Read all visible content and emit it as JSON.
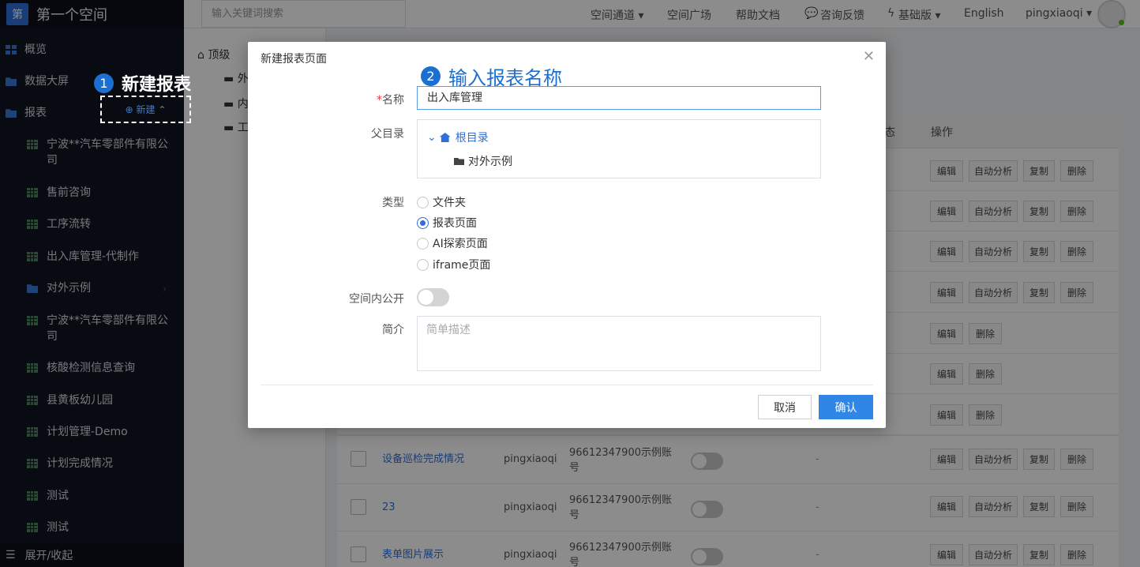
{
  "brand": {
    "logo_char": "第",
    "title": "第一个空间"
  },
  "sidebar": {
    "items": [
      {
        "label": "概览",
        "icon": "dashboard-icon"
      },
      {
        "label": "数据大屏",
        "icon": "folder-icon"
      },
      {
        "label": "报表",
        "icon": "folder-icon"
      }
    ],
    "sub_items": [
      {
        "label": "宁波**汽车零部件有限公司"
      },
      {
        "label": "售前咨询"
      },
      {
        "label": "工序流转"
      },
      {
        "label": "出入库管理-代制作"
      },
      {
        "label": "对外示例"
      },
      {
        "label": "宁波**汽车零部件有限公司"
      },
      {
        "label": "核酸检测信息查询"
      },
      {
        "label": "县黄板幼儿园"
      },
      {
        "label": "计划管理-Demo"
      },
      {
        "label": "计划完成情况"
      },
      {
        "label": "测试"
      },
      {
        "label": "测试"
      }
    ],
    "new_label": "新建",
    "footer_label": "展开/收起"
  },
  "callouts": {
    "one": {
      "num": "1",
      "text": "新建报表"
    },
    "two": {
      "num": "2",
      "text": "输入报表名称"
    }
  },
  "topbar": {
    "search_placeholder": "输入关键词搜索",
    "nav": [
      "空间通道 ▾",
      "空间广场",
      "帮助文档",
      "咨询反馈",
      "基础版 ▾",
      "English",
      "pingxiaoqi ▾"
    ]
  },
  "tree_panel": {
    "top": "顶级",
    "rows": [
      "外",
      "内",
      "工"
    ]
  },
  "table": {
    "col_status": "态",
    "col_action": "操作",
    "btn_edit": "编辑",
    "btn_auto": "自动分析",
    "btn_copy": "复制",
    "btn_delete": "删除",
    "rows": [
      {
        "name": "设备巡检完成情况",
        "owner": "pingxiaoqi",
        "account": "96612347900示例账号",
        "dash": "-"
      },
      {
        "name": "23",
        "owner": "pingxiaoqi",
        "account": "96612347900示例账号",
        "dash": "-"
      },
      {
        "name": "表单图片展示",
        "owner": "pingxiaoqi",
        "account": "96612347900示例账号",
        "dash": "-"
      }
    ]
  },
  "modal": {
    "title": "新建报表页面",
    "name_label": "名称",
    "name_value": "出入库管理",
    "parent_label": "父目录",
    "tree_root": "根目录",
    "tree_child": "对外示例",
    "type_label": "类型",
    "types": [
      "文件夹",
      "报表页面",
      "AI探索页面",
      "iframe页面"
    ],
    "selected_type": "报表页面",
    "public_label": "空间内公开",
    "public_on": false,
    "desc_label": "简介",
    "desc_placeholder": "简单描述",
    "cancel": "取消",
    "ok": "确认"
  },
  "colors": {
    "accent": "#2f86e6",
    "sidebar_bg": "#0f1521"
  }
}
